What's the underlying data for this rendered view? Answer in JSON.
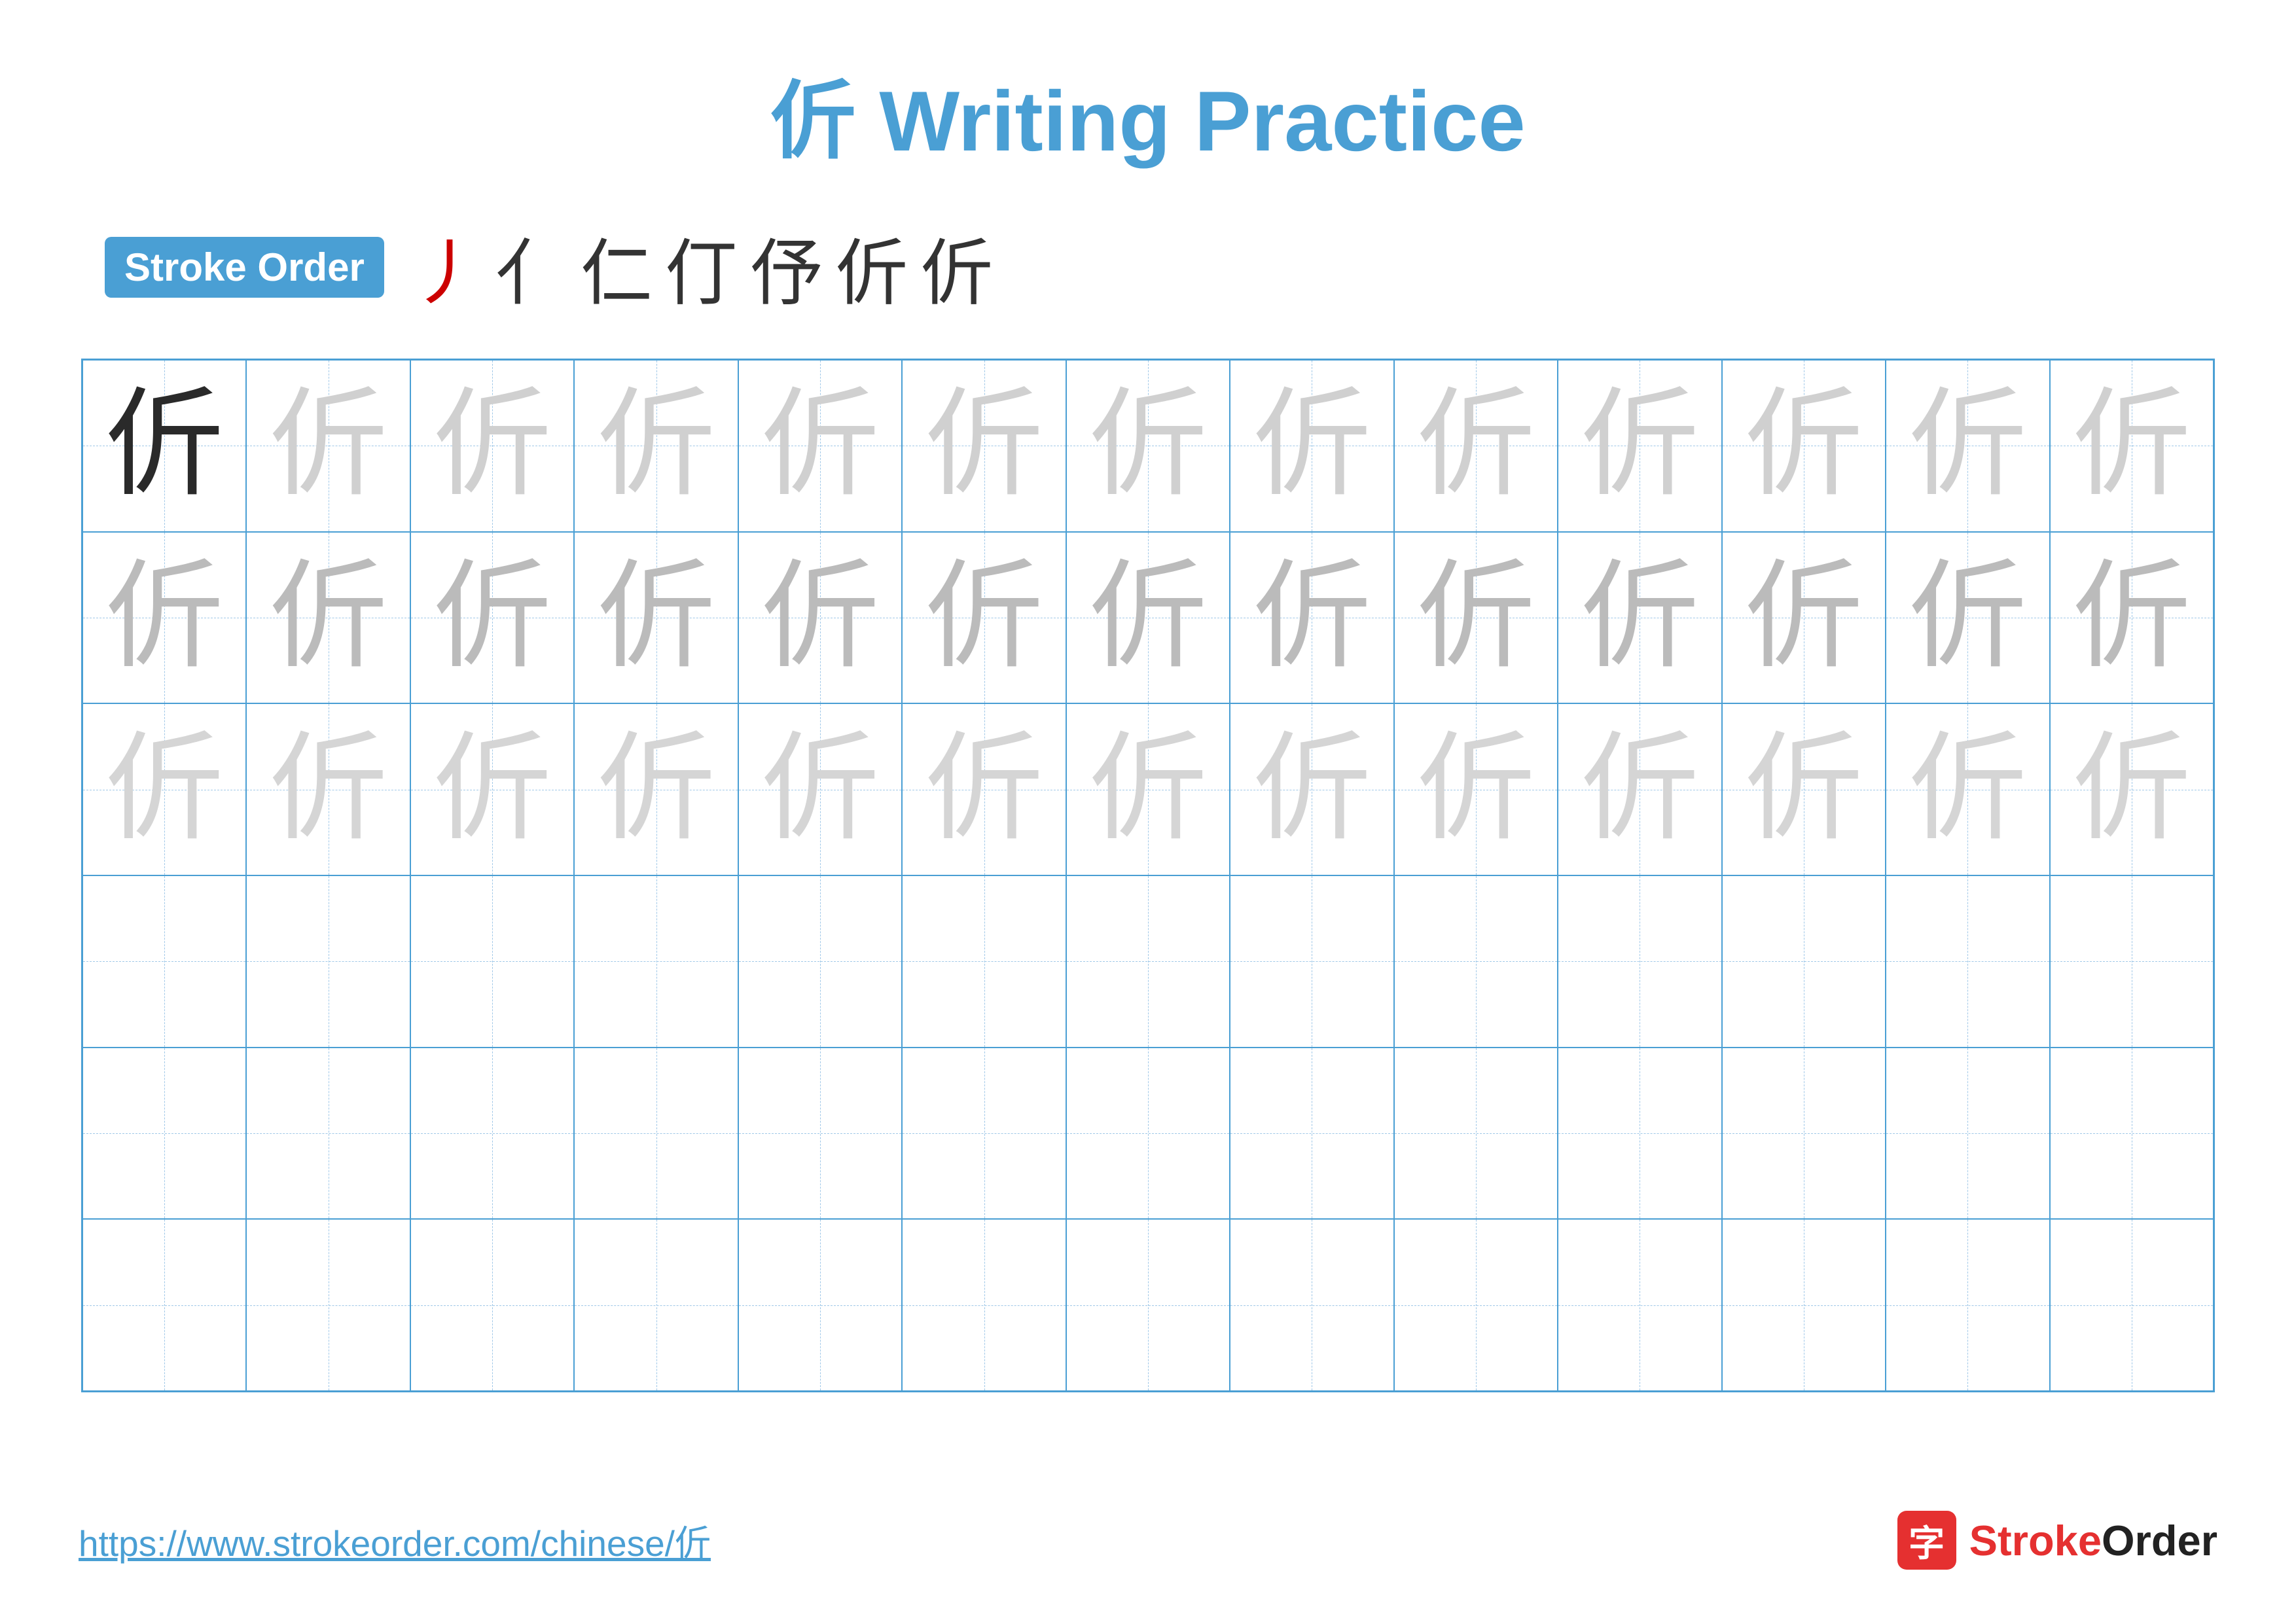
{
  "page": {
    "title": "伒 Writing Practice",
    "title_char": "伒",
    "title_text": "Writing Practice"
  },
  "stroke_order": {
    "badge_label": "Stroke Order",
    "strokes": [
      "丿",
      "亻",
      "仁",
      "仃",
      "伃",
      "伒",
      "伒"
    ]
  },
  "grid": {
    "rows": 6,
    "cols": 13,
    "character": "伒",
    "dark_rows": [
      0
    ],
    "light_rows": [
      1,
      2
    ]
  },
  "footer": {
    "url": "https://www.strokeorder.com/chinese/伒",
    "logo_icon": "字",
    "logo_name": "StrokeOrder"
  },
  "colors": {
    "blue": "#4a9fd4",
    "red": "#e53030",
    "dark_char": "#2a2a2a",
    "light_char": "#cccccc",
    "lighter_char": "#e0e0e0",
    "stroke_red": "#cc0000"
  }
}
